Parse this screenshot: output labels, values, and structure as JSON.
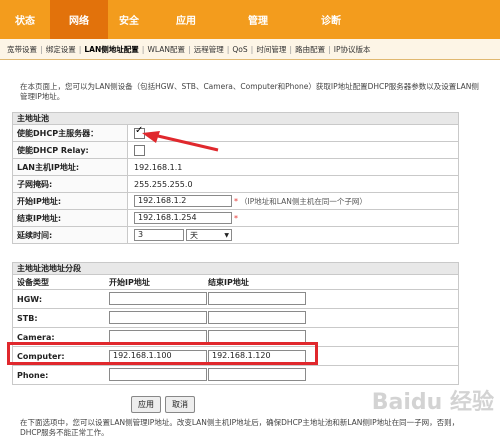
{
  "top_nav": [
    "状态",
    "网络",
    "安全",
    "应用",
    "管理",
    "诊断",
    ""
  ],
  "sub_nav": [
    "宽带设置",
    "绑定设置",
    "LAN侧地址配置",
    "WLAN配置",
    "远程管理",
    "QoS",
    "时间管理",
    "路由配置",
    "IP协议版本"
  ],
  "description": "在本页面上，您可以为LAN侧设备（包括HGW、STB、Camera、Computer和Phone）获取IP地址配置DHCP服务器参数以及设置LAN侧管理IP地址。",
  "host_section": {
    "title": "主地址池",
    "enable_dhcp_label": "使能DHCP主服务器：",
    "enable_relay_label": "使能DHCP Relay:",
    "lan_ip_label": "LAN主机IP地址:",
    "lan_ip": "192.168.1.1",
    "mask_label": "子网掩码:",
    "mask": "255.255.255.0",
    "start_ip_label": "开始IP地址:",
    "start_ip": "192.168.1.2",
    "start_hint": "（IP地址和LAN侧主机在同一个子网）",
    "end_ip_label": "结束IP地址:",
    "end_ip": "192.168.1.254",
    "lease_label": "延续时间:",
    "lease_value": "3",
    "lease_unit": "天",
    "required_mark": "*"
  },
  "segment_section": {
    "title": "主地址池地址分段",
    "col_type": "设备类型",
    "col_start": "开始IP地址",
    "col_end": "结束IP地址",
    "rows": [
      {
        "type": "HGW:",
        "start": "",
        "end": ""
      },
      {
        "type": "STB:",
        "start": "",
        "end": ""
      },
      {
        "type": "Camera:",
        "start": "",
        "end": ""
      },
      {
        "type": "Computer:",
        "start": "192.168.1.100",
        "end": "192.168.1.120"
      },
      {
        "type": "Phone:",
        "start": "",
        "end": ""
      }
    ]
  },
  "buttons": {
    "apply": "应用",
    "cancel": "取消"
  },
  "footnote": "在下面选项中，您可以设置LAN侧管理IP地址。改变LAN侧主机IP地址后，确保DHCP主地址池和新LAN侧IP地址在同一子网，否则，DHCP服务不能正常工作。",
  "watermark": "Baidu 经验",
  "colors": {
    "nav": "#f39c1d",
    "nav_active": "#e2720b",
    "highlight": "#e0282d",
    "arrow": "#e0282d"
  }
}
